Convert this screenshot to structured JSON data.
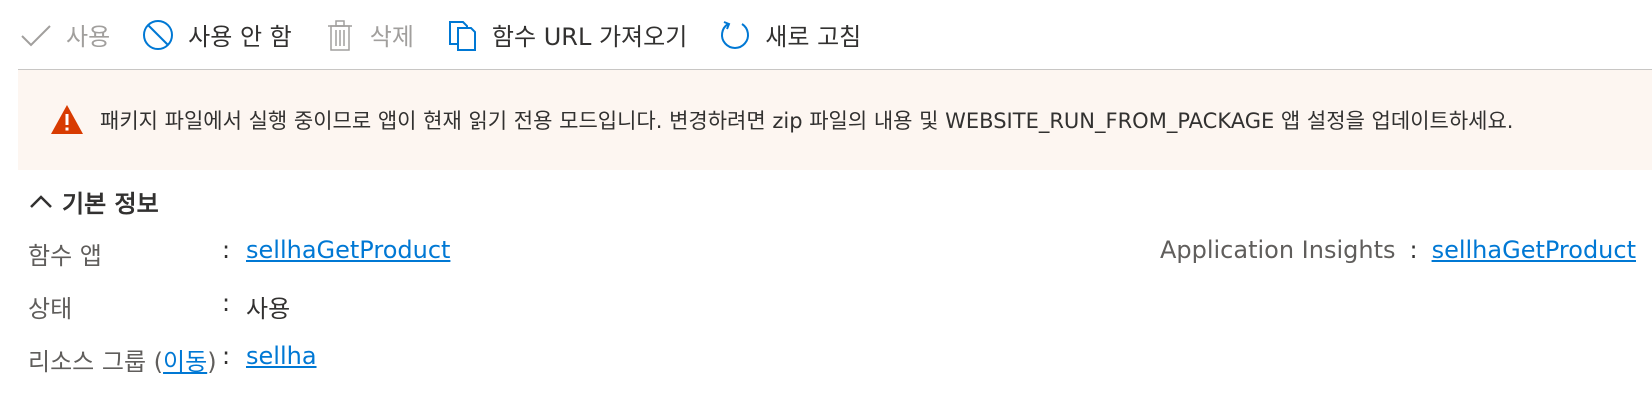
{
  "toolbar": {
    "enable_label": "사용",
    "disable_label": "사용 안 함",
    "delete_label": "삭제",
    "get_url_label": "함수 URL 가져오기",
    "refresh_label": "새로 고침"
  },
  "banner": {
    "message": "패키지 파일에서 실행 중이므로 앱이 현재 읽기 전용 모드입니다. 변경하려면 zip 파일의 내용 및 WEBSITE_RUN_FROM_PACKAGE 앱 설정을 업데이트하세요."
  },
  "essentials": {
    "section_title": "기본 정보",
    "function_app_label": "함수 앱",
    "function_app_value": "sellhaGetProduct",
    "status_label": "상태",
    "status_value": "사용",
    "resource_group_label_prefix": "리소스 그룹 (",
    "resource_group_move": "이동",
    "resource_group_label_suffix": ")",
    "resource_group_value": "sellha",
    "app_insights_label": "Application Insights",
    "app_insights_value": "sellhaGetProduct",
    "colon": ":"
  },
  "colors": {
    "link": "#0078d4",
    "warning": "#d83b01",
    "banner_bg": "#fdf6f1",
    "disabled_text": "#a19f9d"
  }
}
